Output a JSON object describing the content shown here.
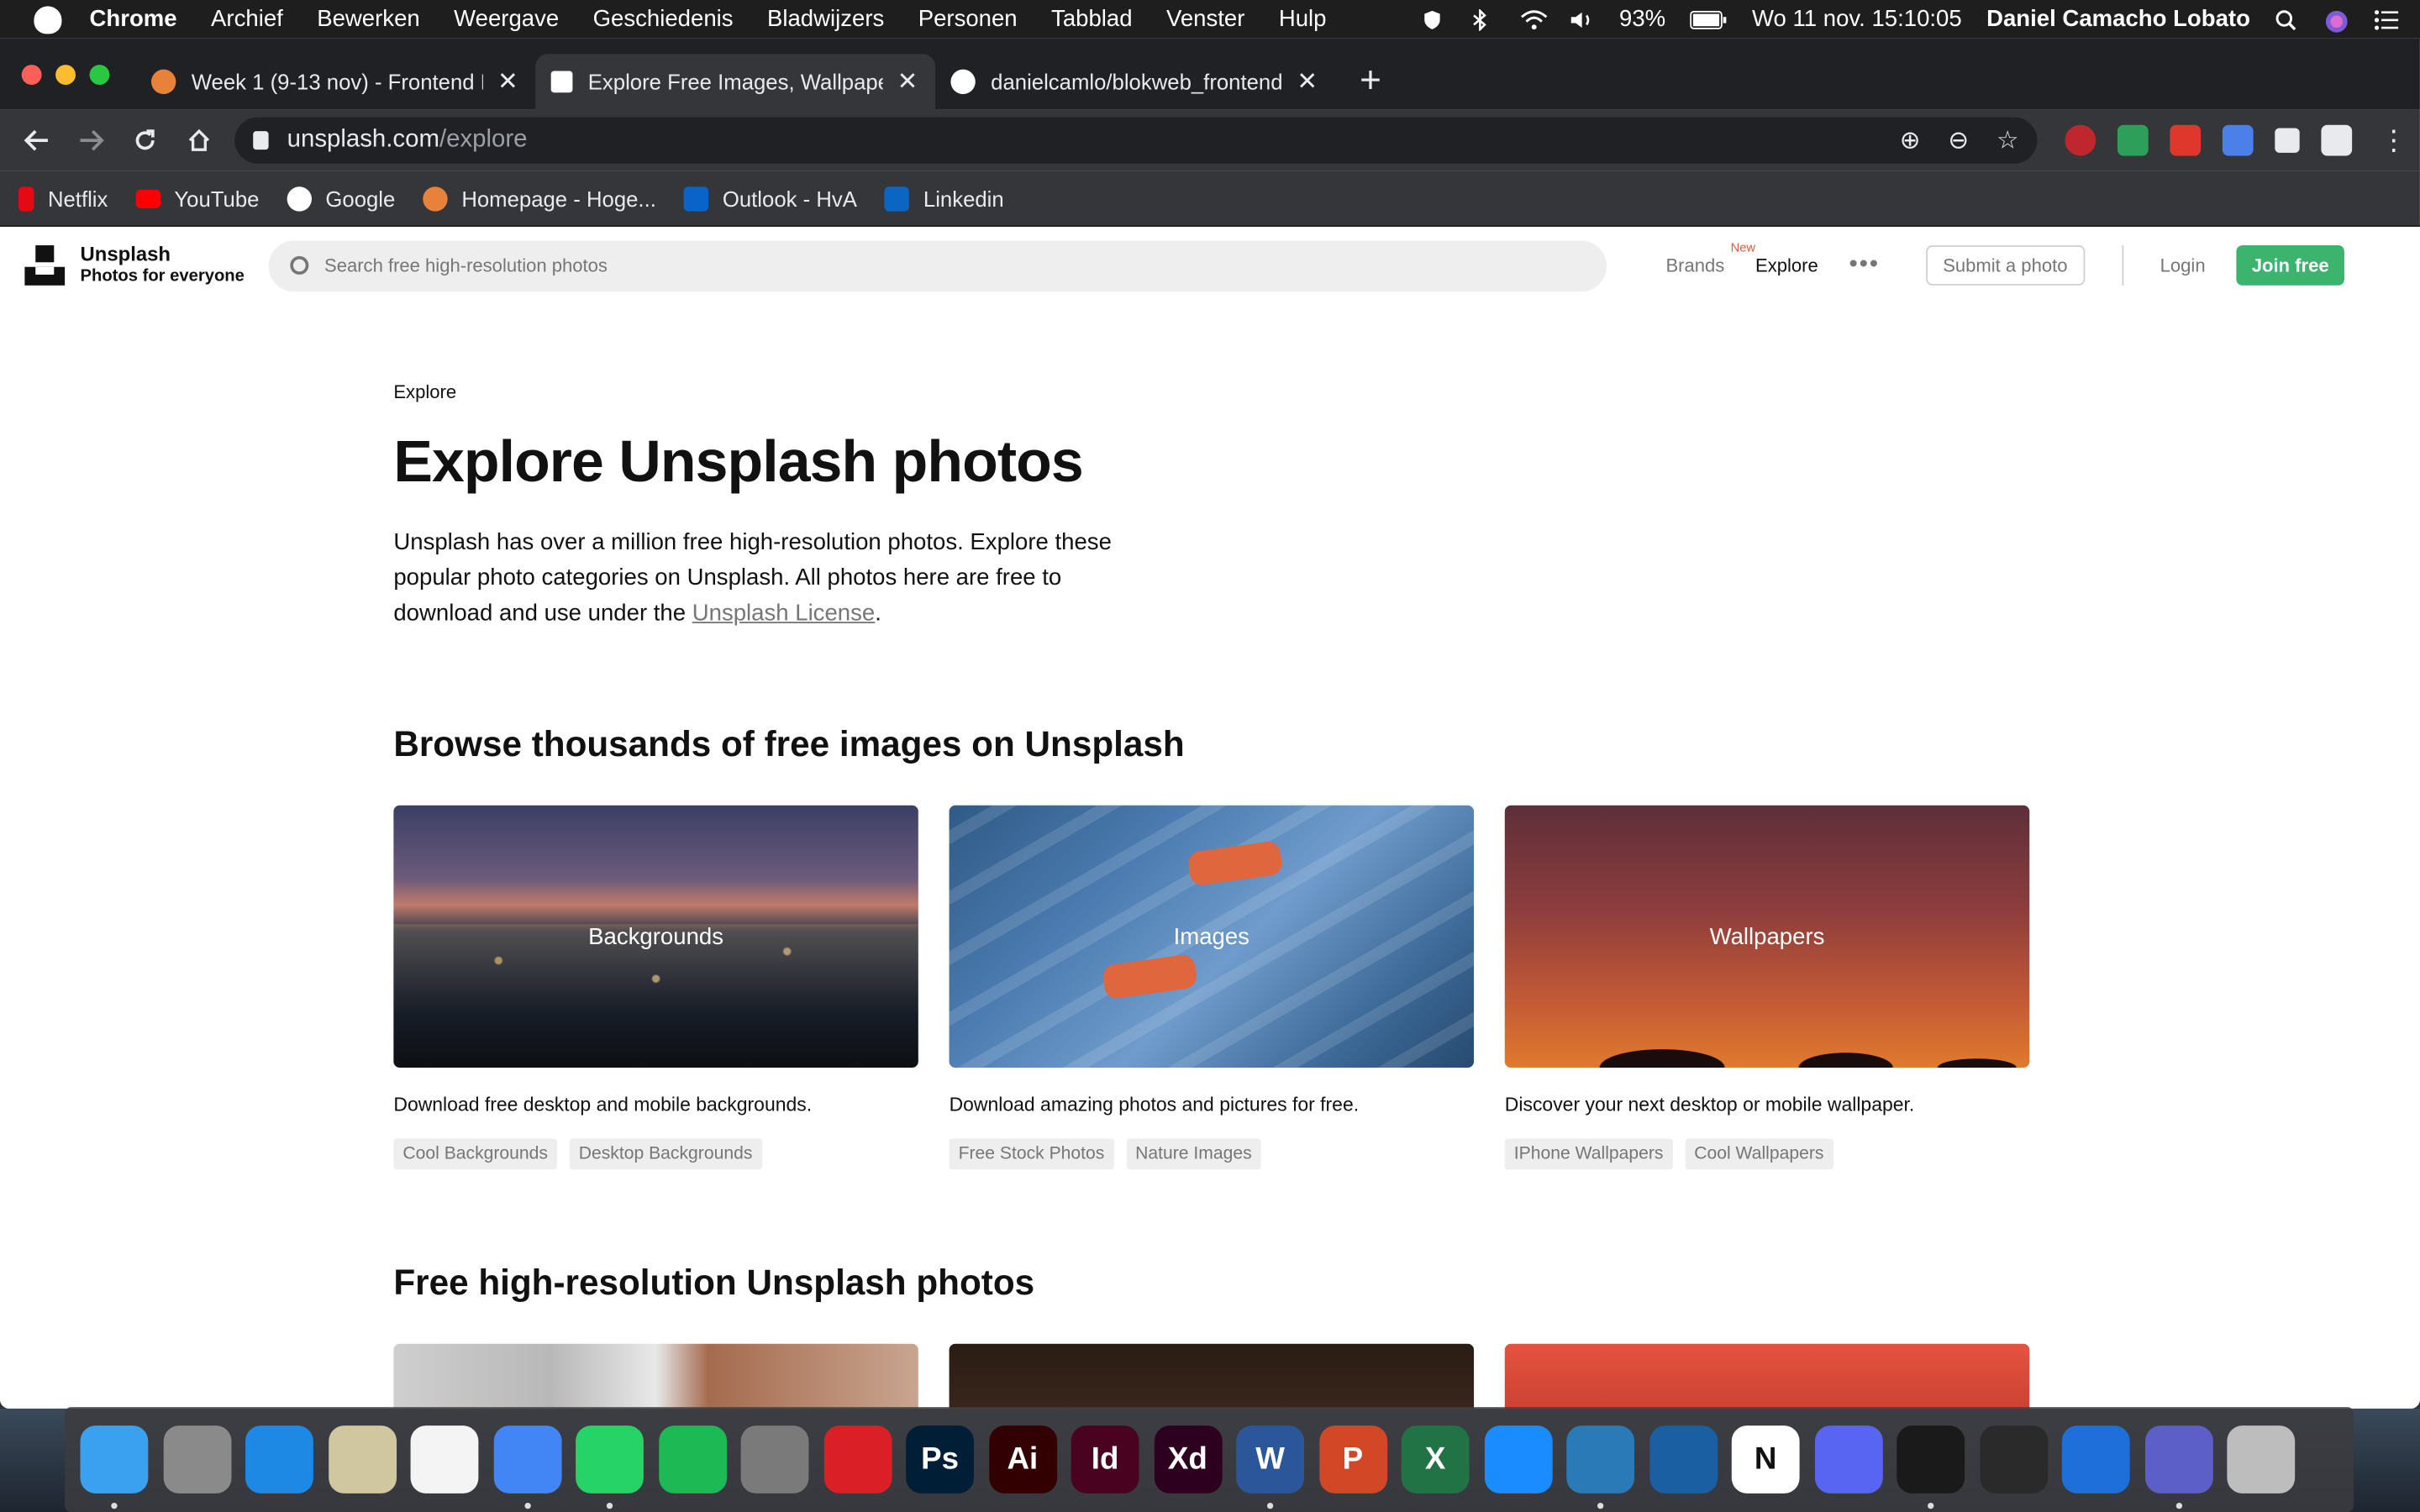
{
  "menubar": {
    "app": "Chrome",
    "items": [
      "Archief",
      "Bewerken",
      "Weergave",
      "Geschiedenis",
      "Bladwijzers",
      "Personen",
      "Tabblad",
      "Venster",
      "Hulp"
    ],
    "battery": "93%",
    "datetime": "Wo 11 nov.  15:10:05",
    "user": "Daniel Camacho Lobato"
  },
  "tabs": [
    {
      "title": "Week 1 (9-13 nov) - Frontend D",
      "favicon_color": "#e8813a",
      "active": false
    },
    {
      "title": "Explore Free Images, Wallpape",
      "favicon_color": "#ffffff",
      "active": true
    },
    {
      "title": "danielcamlo/blokweb_frontend",
      "favicon_color": "#ffffff",
      "active": false
    }
  ],
  "toolbar": {
    "url_host": "unsplash.com",
    "url_path": "/explore"
  },
  "bookmarks": [
    {
      "label": "Netflix",
      "color": "#e50914"
    },
    {
      "label": "YouTube",
      "color": "#ff0000"
    },
    {
      "label": "Google",
      "color": "#ffffff"
    },
    {
      "label": "Homepage - Hoge...",
      "color": "#e8813a"
    },
    {
      "label": "Outlook - HvA",
      "color": "#0a64c8"
    },
    {
      "label": "Linkedin",
      "color": "#0a66c2"
    }
  ],
  "site": {
    "brand_name": "Unsplash",
    "brand_tagline": "Photos for everyone",
    "search_placeholder": "Search free high-resolution photos",
    "nav_brands": "Brands",
    "nav_brands_badge": "New",
    "nav_explore": "Explore",
    "nav_more": "•••",
    "submit_label": "Submit a photo",
    "login_label": "Login",
    "join_label": "Join free",
    "accent_color": "#3cb46e"
  },
  "main": {
    "breadcrumb": "Explore",
    "title": "Explore Unsplash photos",
    "intro_text": "Unsplash has over a million free high-resolution photos. Explore these popular photo categories on Unsplash. All photos here are free to download and use under the ",
    "intro_link": "Unsplash License",
    "intro_end": ".",
    "section1_title": "Browse thousands of free images on Unsplash",
    "categories": [
      {
        "label": "Backgrounds",
        "desc": "Download free desktop and mobile backgrounds.",
        "tags": [
          "Cool Backgrounds",
          "Desktop Backgrounds"
        ]
      },
      {
        "label": "Images",
        "desc": "Download amazing photos and pictures for free.",
        "tags": [
          "Free Stock Photos",
          "Nature Images"
        ]
      },
      {
        "label": "Wallpapers",
        "desc": "Discover your next desktop or mobile wallpaper.",
        "tags": [
          "IPhone Wallpapers",
          "Cool Wallpapers"
        ]
      }
    ],
    "section2_title": "Free high-resolution Unsplash photos"
  },
  "dock": [
    {
      "name": "finder-icon",
      "color": "#3aa0f0",
      "glyph": "",
      "running": true
    },
    {
      "name": "launchpad-icon",
      "color": "#8a8a8a",
      "glyph": "",
      "running": false
    },
    {
      "name": "safari-icon",
      "color": "#1e88e5",
      "glyph": "",
      "running": false
    },
    {
      "name": "mail-icon",
      "color": "#d0c6a0",
      "glyph": "",
      "running": false
    },
    {
      "name": "photos-icon",
      "color": "#f4f4f4",
      "glyph": "",
      "running": false
    },
    {
      "name": "chrome-icon",
      "color": "#4285f4",
      "glyph": "",
      "running": true
    },
    {
      "name": "whatsapp-icon",
      "color": "#25d366",
      "glyph": "",
      "running": true
    },
    {
      "name": "spotify-icon",
      "color": "#1db954",
      "glyph": "",
      "running": false
    },
    {
      "name": "system-preferences-icon",
      "color": "#7a7a7a",
      "glyph": "",
      "running": false
    },
    {
      "name": "creative-cloud-icon",
      "color": "#da1f26",
      "glyph": "",
      "running": false
    },
    {
      "name": "photoshop-icon",
      "color": "#001e36",
      "glyph": "Ps",
      "running": false
    },
    {
      "name": "illustrator-icon",
      "color": "#330000",
      "glyph": "Ai",
      "running": false
    },
    {
      "name": "indesign-icon",
      "color": "#49021f",
      "glyph": "Id",
      "running": false
    },
    {
      "name": "xd-icon",
      "color": "#2e001f",
      "glyph": "Xd",
      "running": false
    },
    {
      "name": "word-icon",
      "color": "#2b579a",
      "glyph": "W",
      "running": true
    },
    {
      "name": "powerpoint-icon",
      "color": "#d24726",
      "glyph": "P",
      "running": false
    },
    {
      "name": "excel-icon",
      "color": "#217346",
      "glyph": "X",
      "running": false
    },
    {
      "name": "app-store-icon",
      "color": "#1a8cff",
      "glyph": "",
      "running": false
    },
    {
      "name": "screens-icon",
      "color": "#2a7ab8",
      "glyph": "",
      "running": true
    },
    {
      "name": "mountain-app-icon",
      "color": "#1b5fa3",
      "glyph": "",
      "running": false
    },
    {
      "name": "notion-icon",
      "color": "#ffffff",
      "glyph": "N",
      "running": false
    },
    {
      "name": "discord-icon",
      "color": "#5865f2",
      "glyph": "",
      "running": false
    },
    {
      "name": "acrobat-icon",
      "color": "#1a1a1a",
      "glyph": "",
      "running": true
    },
    {
      "name": "quicktime-icon",
      "color": "#2a2a2a",
      "glyph": "",
      "running": false
    },
    {
      "name": "sync-icon",
      "color": "#1e6fd9",
      "glyph": "",
      "running": false
    },
    {
      "name": "teams-icon",
      "color": "#5b5fc7",
      "glyph": "",
      "running": true
    },
    {
      "name": "trash-icon",
      "color": "#bdbdbd",
      "glyph": "",
      "running": false
    }
  ]
}
